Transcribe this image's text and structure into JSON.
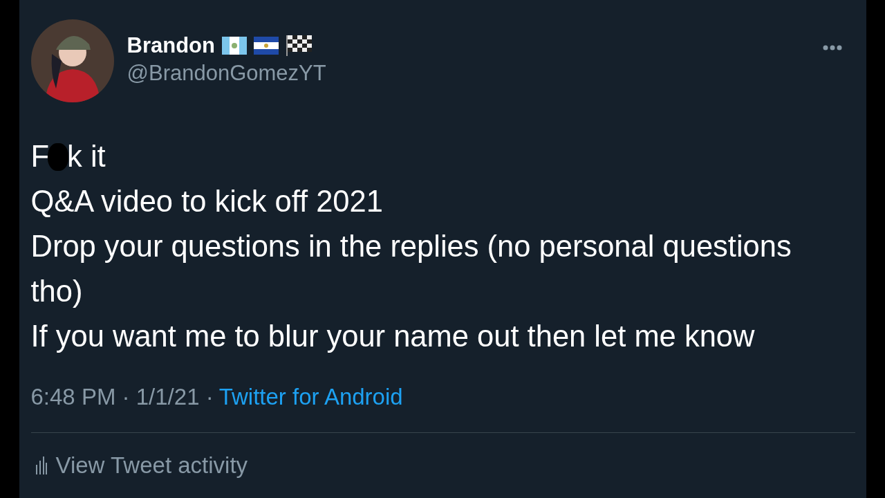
{
  "author": {
    "name": "Brandon",
    "handle": "@BrandonGomezYT",
    "flags": [
      {
        "kind": "guatemala"
      },
      {
        "kind": "el-salvador"
      },
      {
        "kind": "checkered"
      }
    ]
  },
  "tweet": {
    "lines": [
      {
        "kind": "censored",
        "before": "F",
        "after": "k it"
      },
      {
        "kind": "plain",
        "text": "Q&A video to kick off 2021"
      },
      {
        "kind": "plain",
        "text": "Drop your questions in the replies (no personal questions tho)"
      },
      {
        "kind": "plain",
        "text": "If you want me to blur your name out then let me know"
      }
    ]
  },
  "meta": {
    "time": "6:48 PM",
    "separator": "·",
    "date": "1/1/21",
    "source": "Twitter for Android"
  },
  "activity": {
    "label": "View Tweet activity"
  }
}
